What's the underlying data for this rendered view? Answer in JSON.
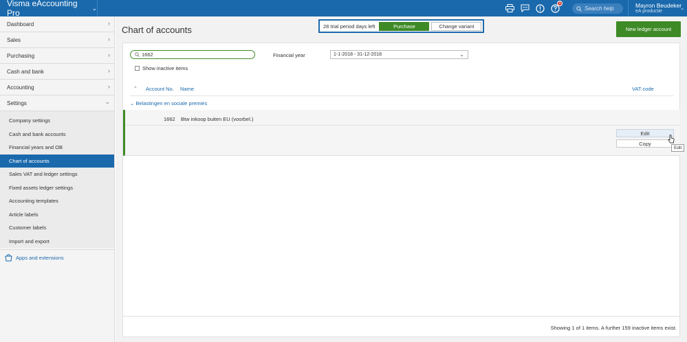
{
  "app": {
    "title": "Visma eAccounting Pro"
  },
  "header": {
    "search_placeholder": "Search help",
    "user_name": "Mayron Beudeker",
    "user_org": "eA productie",
    "notification_count": "1"
  },
  "sidebar": {
    "items": [
      {
        "label": "Dashboard"
      },
      {
        "label": "Sales"
      },
      {
        "label": "Purchasing"
      },
      {
        "label": "Cash and bank"
      },
      {
        "label": "Accounting"
      },
      {
        "label": "Settings"
      }
    ],
    "settings_sub": [
      {
        "label": "Company settings"
      },
      {
        "label": "Cash and bank accounts"
      },
      {
        "label": "Financial years and OB"
      },
      {
        "label": "Chart of accounts"
      },
      {
        "label": "Sales VAT and ledger settings"
      },
      {
        "label": "Fixed assets ledger settings"
      },
      {
        "label": "Accounting templates"
      },
      {
        "label": "Article labels"
      },
      {
        "label": "Customer labels"
      },
      {
        "label": "Import and export"
      }
    ],
    "apps_label": "Apps and extensions"
  },
  "main": {
    "title": "Chart of accounts",
    "trial_text": "28 trial period days left",
    "purchase_label": "Purchase",
    "change_variant_label": "Change variant",
    "new_account_label": "New ledger account",
    "filter_value": "1662",
    "financial_year_label": "Financial year",
    "financial_year_value": "1-1-2018 - 31-12-2018",
    "show_inactive_label": "Show inactive items",
    "columns": {
      "account_no": "Account No.",
      "name": "Name",
      "vat_code": "VAT code"
    },
    "group_label": "Belastingen en sociale premies",
    "rows": [
      {
        "account_no": "1662",
        "name": "Btw inkoop buiten EU (voorbel.)"
      }
    ],
    "edit_label": "Edit",
    "copy_label": "Copy",
    "tooltip": "Edit",
    "footer_text": "Showing 1 of 1 items. A further 159 inactive items exist."
  },
  "colors": {
    "brand_blue": "#1a69ac",
    "accent_green": "#3e8a26"
  }
}
